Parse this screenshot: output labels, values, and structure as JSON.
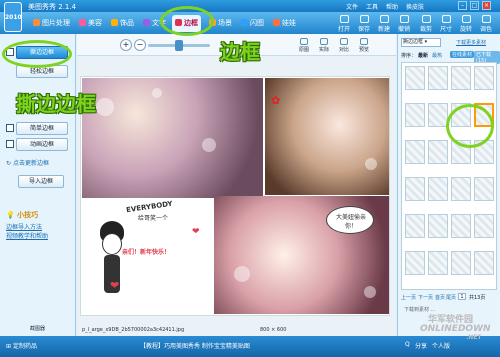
{
  "window": {
    "app_name": "美图秀秀",
    "version": "2.1.4",
    "logo_text": "2010"
  },
  "menu": [
    "文件",
    "工具",
    "帮助",
    "换皮肤"
  ],
  "tabs": [
    {
      "label": "图片处理",
      "color": "#ff8c3a"
    },
    {
      "label": "美容",
      "color": "#ff5a9a"
    },
    {
      "label": "饰品",
      "color": "#ffb400"
    },
    {
      "label": "文字",
      "color": "#9b5de5"
    },
    {
      "label": "边框",
      "color": "#e03050"
    },
    {
      "label": "场景",
      "color": "#ffa030"
    },
    {
      "label": "闪图",
      "color": "#30a0ff"
    },
    {
      "label": "娃娃",
      "color": "#ff7040"
    }
  ],
  "active_tab": "边框",
  "tools": [
    "打开",
    "保存",
    "新建",
    "撤销",
    "裁剪",
    "尺寸",
    "旋转",
    "调色"
  ],
  "left_panel": {
    "buttons": [
      "撕边边框",
      "轻松边框",
      "简单边框",
      "动画边框"
    ],
    "link": "点击更新边框",
    "import": "导入边框",
    "tip_title": "小技巧",
    "tip_lines": [
      "边框导入方法",
      "视频教学和帮助"
    ],
    "bottom": "截图器"
  },
  "zoombar": {
    "ops": [
      "原图",
      "实际",
      "对比",
      "预览"
    ],
    "zoom_level": 0.5
  },
  "photo": {
    "texts": [
      "EVERYBODY",
      "给哥笑一个",
      "亲们！新年快乐！",
      "大美妞偷亲你！"
    ],
    "filename": "p_l_arge_x9DB_2b5700002a3c42411.jpg",
    "size_text": "800 × 600"
  },
  "right_panel": {
    "header": "撕边边框",
    "link": "下载更多素材",
    "sort_label": "排序：",
    "sort_options": [
      "最新",
      "最热"
    ],
    "subtabs": [
      "在线素材",
      "已下载(15)"
    ],
    "pager": [
      "上一页",
      "下一页",
      "首页",
      "尾页"
    ],
    "page_input": "1",
    "page_total": "共13页",
    "status": "下载到素材 ..."
  },
  "bottom_bar": {
    "left": "定制药品",
    "center": "【教程】巧用美图秀秀 制作宝宝精美贴图",
    "right_links": [
      "Q",
      "分享",
      "个人版"
    ]
  },
  "annotations": {
    "big": "边框",
    "small": "撕边边框"
  },
  "watermark": {
    "top": "华军软件园",
    "middle": "ONLINEDOWN",
    "bottom": ".NET"
  },
  "colors": {
    "accent": "#2184cc",
    "annot": "#7ed321"
  }
}
